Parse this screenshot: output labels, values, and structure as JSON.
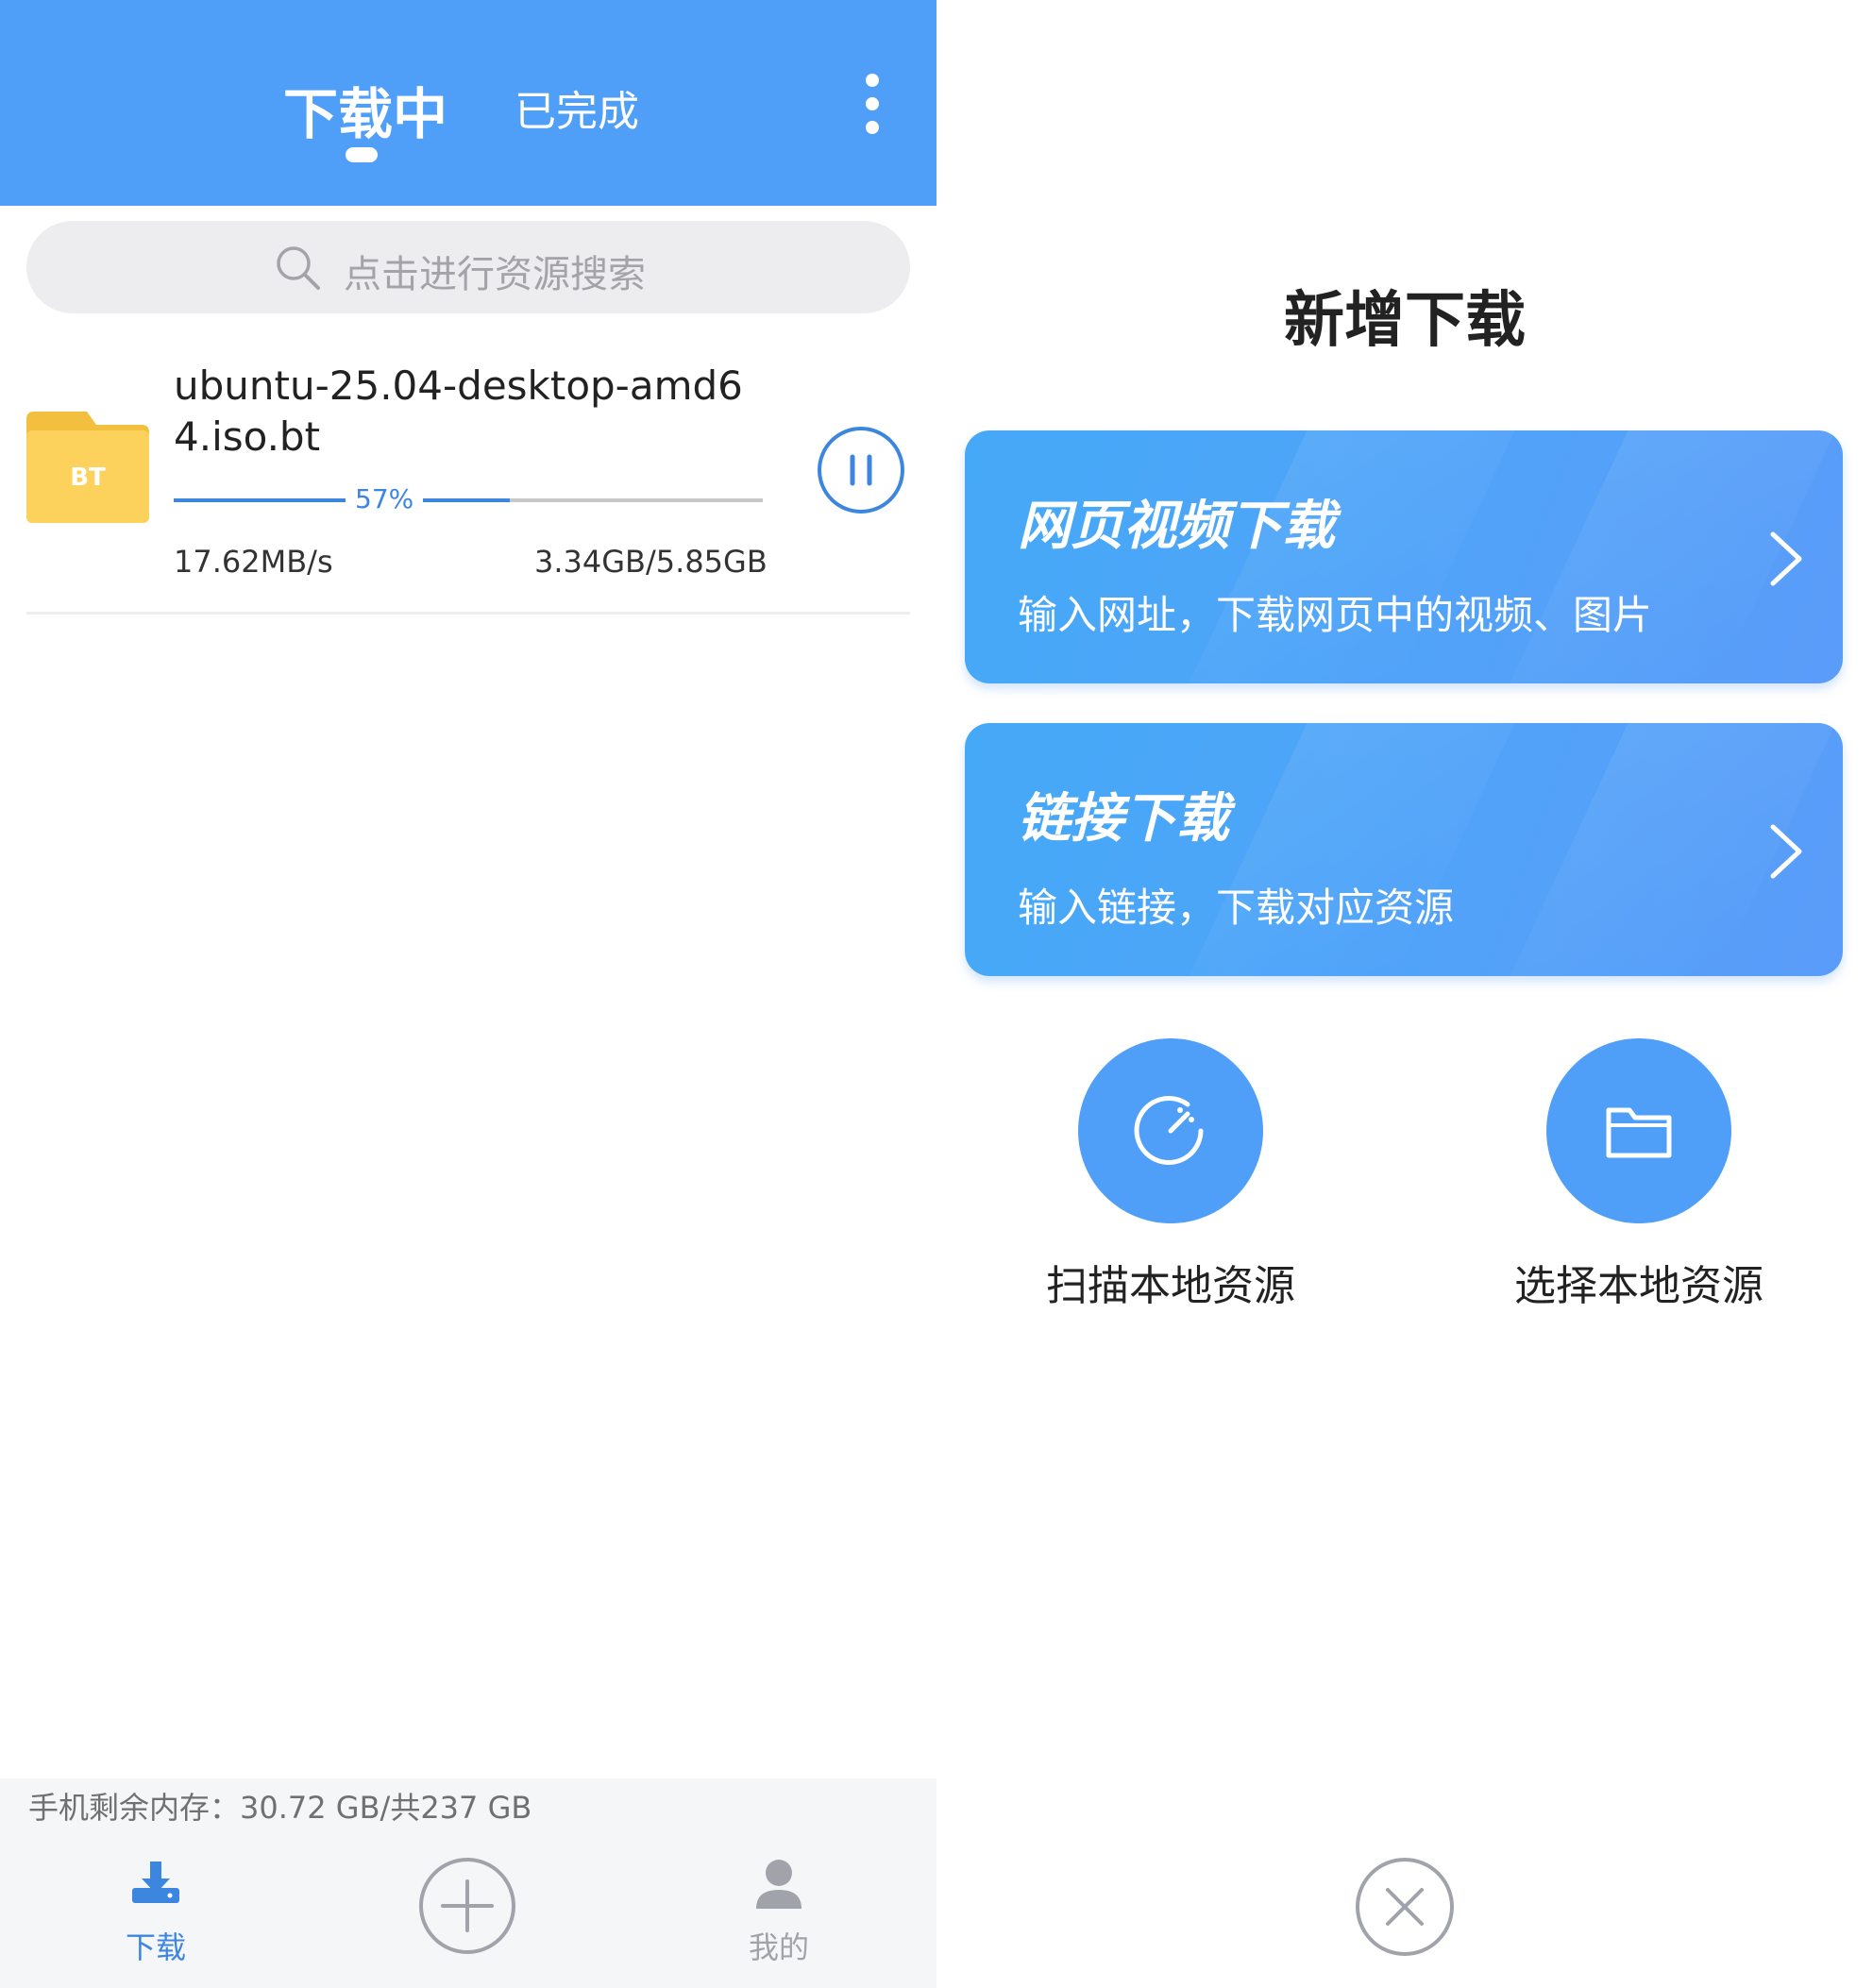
{
  "left": {
    "header": {
      "tabs": [
        {
          "label": "下载中",
          "active": true
        },
        {
          "label": "已完成",
          "active": false
        }
      ],
      "more_icon": "more-vertical-icon"
    },
    "search": {
      "placeholder": "点击进行资源搜索",
      "icon": "search-icon"
    },
    "downloads": [
      {
        "file_badge": "BT",
        "file_name": "ubuntu-25.04-desktop-amd64.iso.bt",
        "progress_percent": 57,
        "progress_label": "57%",
        "speed": "17.62MB/s",
        "size_progress": "3.34GB/5.85GB",
        "action_icon": "pause-icon"
      }
    ],
    "storage_text": "手机剩余内存：30.72 GB/共237 GB",
    "bottom_nav": {
      "download_label": "下载",
      "mine_label": "我的",
      "add_icon": "plus-circle-icon"
    }
  },
  "right": {
    "title": "新增下载",
    "options": [
      {
        "title": "网页视频下载",
        "description": "输入网址，下载网页中的视频、图片",
        "icon": "chevron-right-icon"
      },
      {
        "title": "链接下载",
        "description": "输入链接，下载对应资源",
        "icon": "chevron-right-icon"
      }
    ],
    "actions": [
      {
        "label": "扫描本地资源",
        "icon": "scan-icon"
      },
      {
        "label": "选择本地资源",
        "icon": "folder-icon"
      }
    ],
    "close_icon": "close-circle-icon"
  },
  "colors": {
    "brand_blue": "#4f9ff8",
    "progress_blue": "#3d86e0",
    "folder_yellow": "#fdd25c"
  }
}
